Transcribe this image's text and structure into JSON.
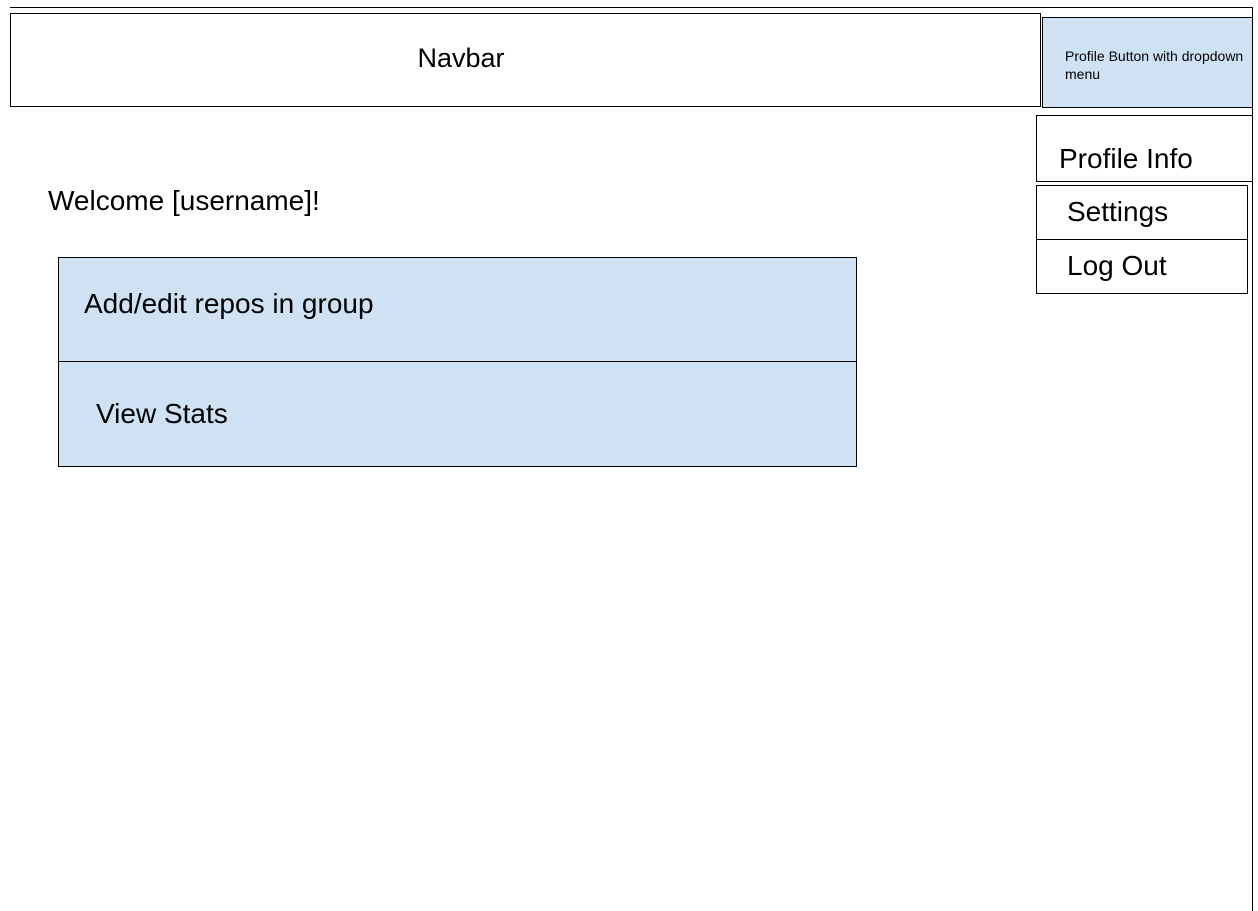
{
  "navbar": {
    "label": "Navbar",
    "profile_button_label": "Profile Button with dropdown menu"
  },
  "dropdown": {
    "items": [
      {
        "label": "Profile Info"
      },
      {
        "label": "Settings"
      },
      {
        "label": "Log Out"
      }
    ]
  },
  "main": {
    "welcome": "Welcome [username]!",
    "actions": [
      {
        "label": "Add/edit repos in group"
      },
      {
        "label": "View Stats"
      }
    ]
  },
  "colors": {
    "button_fill": "#cfe2f3",
    "border": "#000000",
    "background": "#ffffff"
  }
}
